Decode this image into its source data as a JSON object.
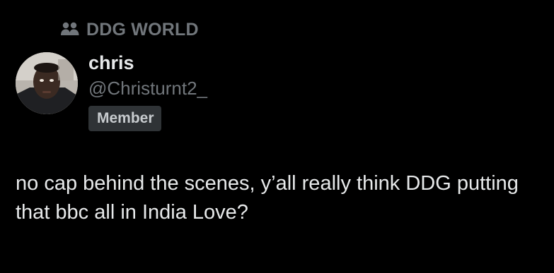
{
  "community": {
    "name": "DDG WORLD",
    "icon": "community-people-icon"
  },
  "author": {
    "display_name": "chris",
    "handle": "@Christurnt2_",
    "badge": "Member",
    "avatar_icon": "avatar-photo"
  },
  "post": {
    "text": "no cap behind the scenes, y’all really think DDG putting that bbc all in India Love?"
  },
  "colors": {
    "background": "#000000",
    "primary_text": "#e7e9ea",
    "secondary_text": "#71767b",
    "badge_bg": "#2f3336"
  }
}
